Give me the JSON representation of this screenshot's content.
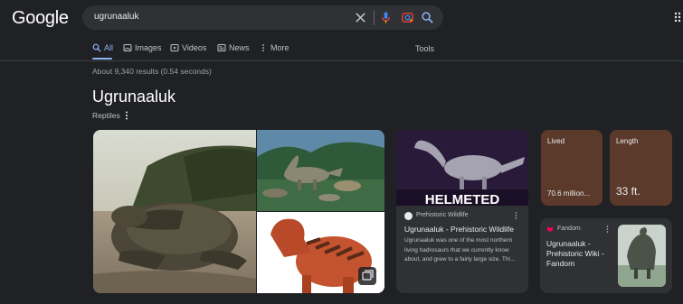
{
  "header": {
    "logo": "Google",
    "search_query": "ugrunaaluk"
  },
  "tabs": [
    {
      "label": "All",
      "icon": "search-icon",
      "active": true
    },
    {
      "label": "Images",
      "icon": "image-icon"
    },
    {
      "label": "Videos",
      "icon": "video-icon"
    },
    {
      "label": "News",
      "icon": "news-icon"
    },
    {
      "label": "More",
      "icon": "more-vert-icon"
    }
  ],
  "tools_label": "Tools",
  "result_stats": "About 9,340 results (0.54 seconds)",
  "knowledge_panel": {
    "title": "Ugrunaaluk",
    "subtitle": "Reptiles",
    "card": {
      "image_caption_text": "HELMETED",
      "source": "Prehistoric Wildlife",
      "title": "Ugrunaaluk - Prehistoric Wildlife",
      "description": "Ugrunaaluk was one of the most northern living hadrosaurs that we currently know about, and grew to a fairly large size. Thi..."
    },
    "facts": [
      {
        "label": "Lived",
        "value": "70.6 million..."
      },
      {
        "label": "Length",
        "value": "33 ft."
      }
    ],
    "fandom": {
      "source": "Fandom",
      "title": "Ugrunaaluk - Prehistoric Wiki - Fandom"
    }
  },
  "colors": {
    "background": "#202124",
    "accent": "#8ab4f8",
    "fact_bg": "#5b3a2b"
  }
}
